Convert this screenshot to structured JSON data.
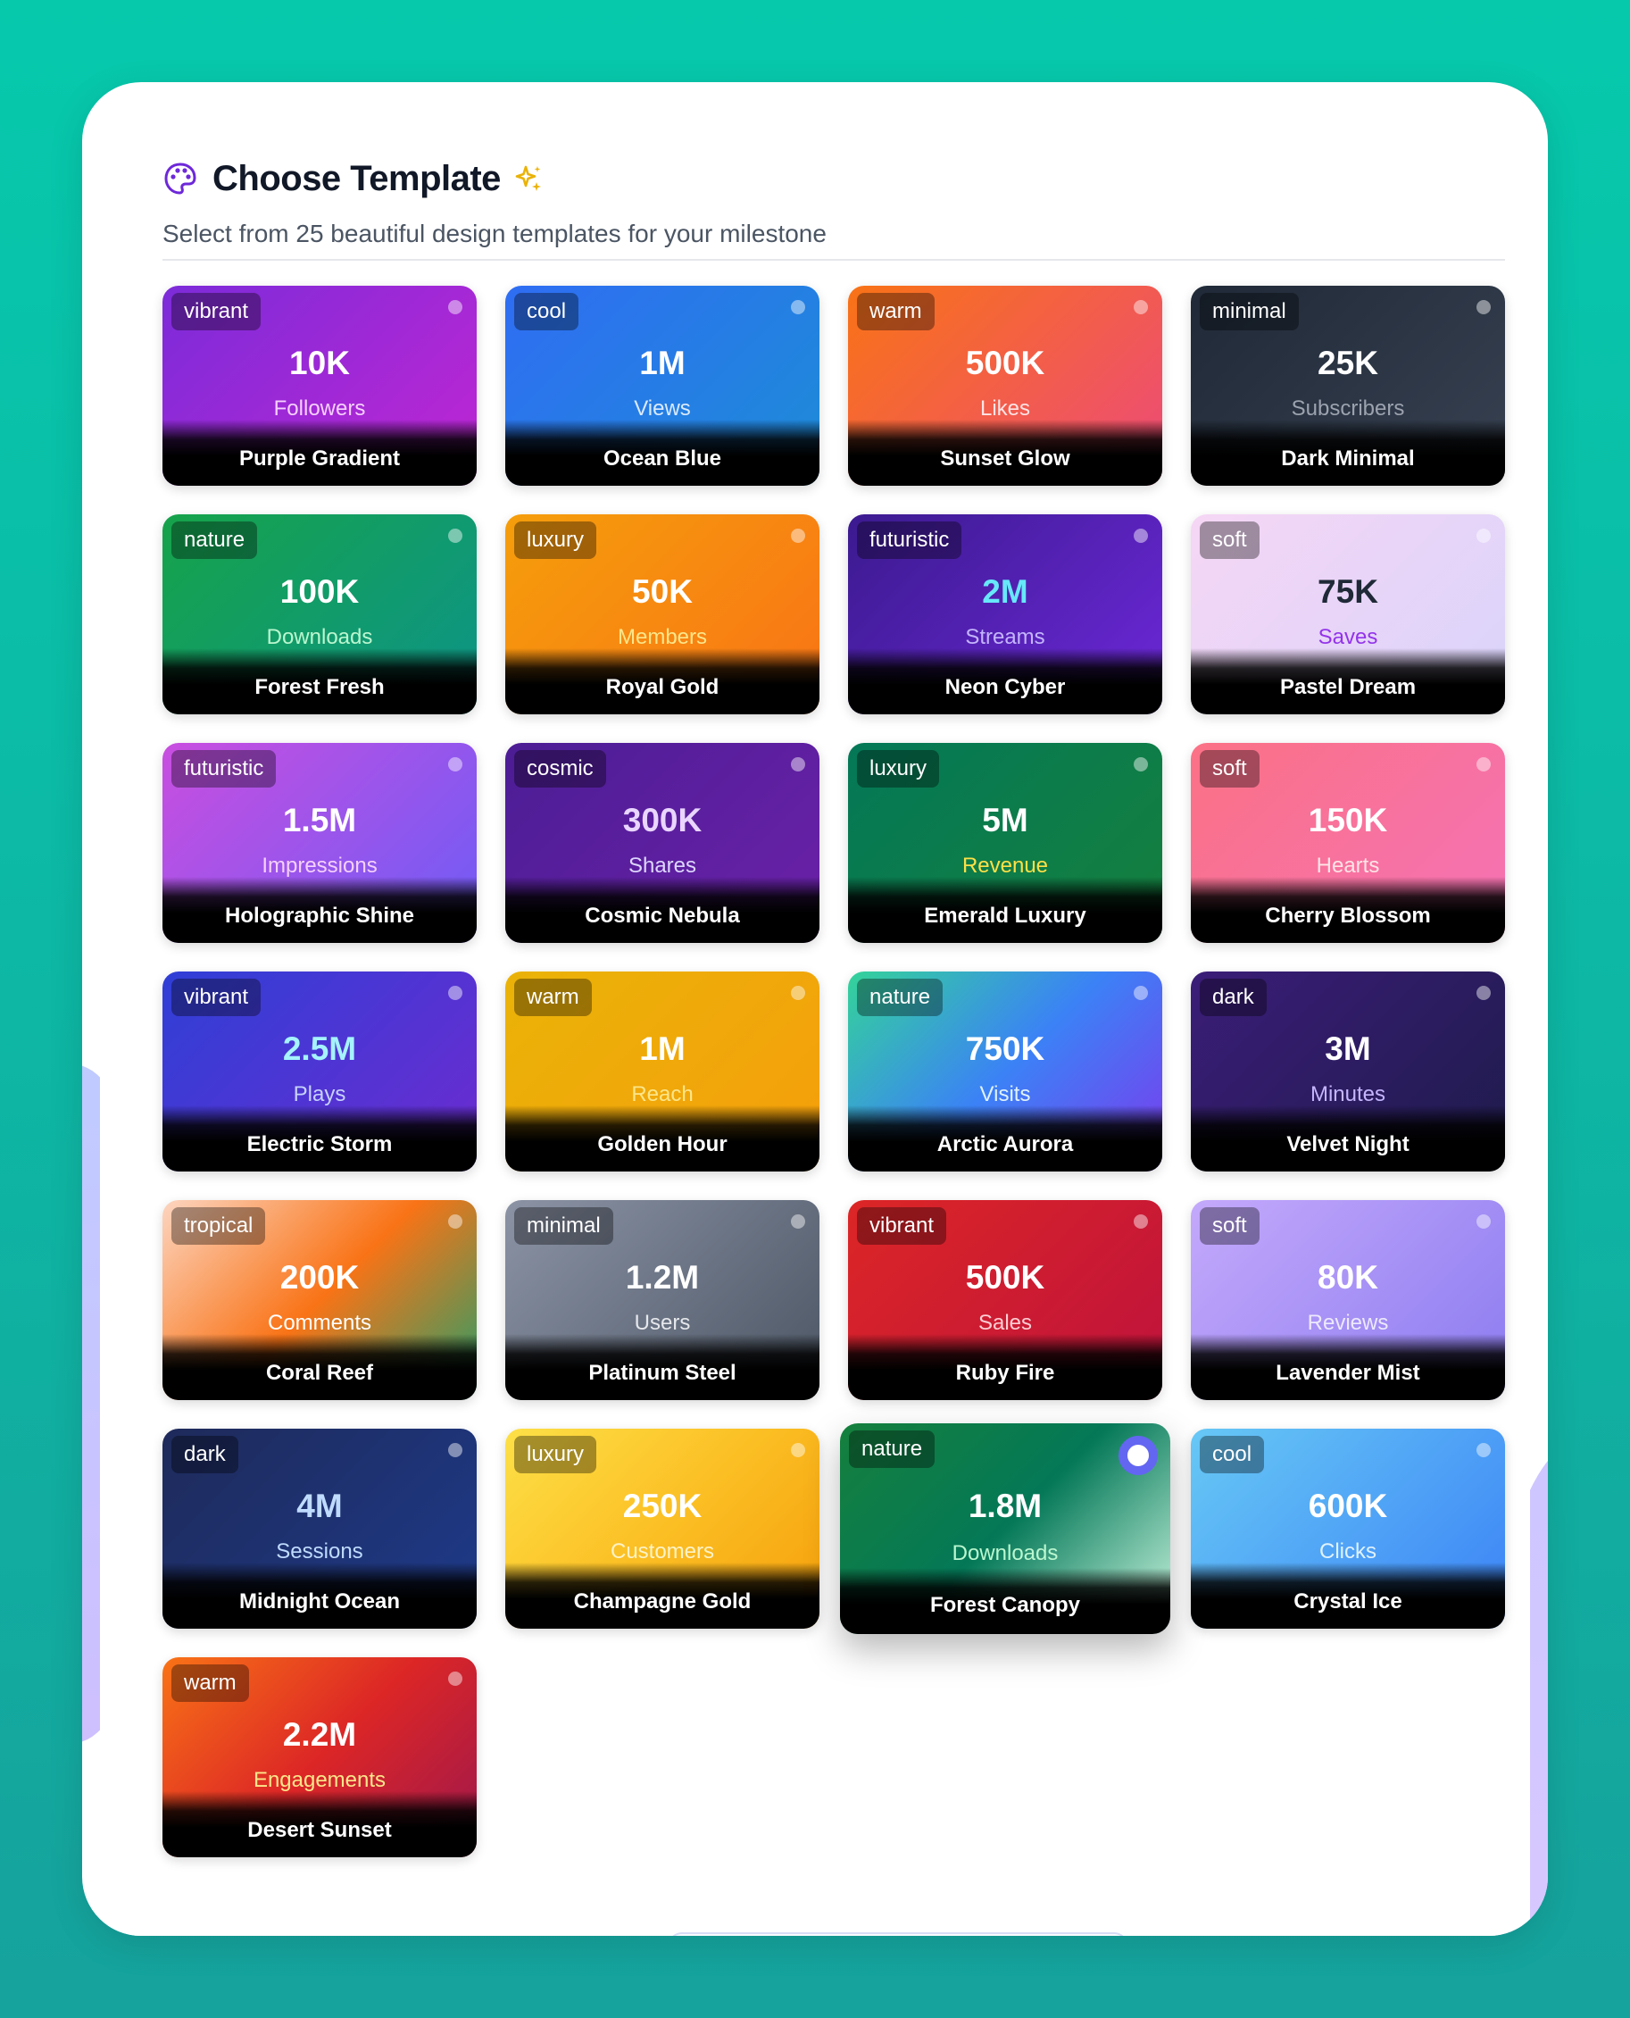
{
  "header": {
    "title": "Choose Template",
    "subtitle": "Select from 25 beautiful design templates for your milestone",
    "title_icon": "palette-icon",
    "title_accent_icon": "sparkle-icon"
  },
  "selected_template": "Forest Canopy",
  "templates": [
    {
      "category": "vibrant",
      "value": "10K",
      "metric": "Followers",
      "name": "Purple Gradient",
      "gradient": [
        "#7c2bd9",
        "#c026d3"
      ],
      "metric_color": "#f5d0fe"
    },
    {
      "category": "cool",
      "value": "1M",
      "metric": "Views",
      "name": "Ocean Blue",
      "gradient": [
        "#2f6df3",
        "#1d8cd7"
      ],
      "metric_color": "#dbeafe"
    },
    {
      "category": "warm",
      "value": "500K",
      "metric": "Likes",
      "name": "Sunset Glow",
      "gradient": [
        "#f97316",
        "#ec4a7a"
      ],
      "metric_color": "#ffe4e6"
    },
    {
      "category": "minimal",
      "value": "25K",
      "metric": "Subscribers",
      "name": "Dark Minimal",
      "gradient": [
        "#1f2937",
        "#374151"
      ],
      "metric_color": "#9ca3af"
    },
    {
      "category": "nature",
      "value": "100K",
      "metric": "Downloads",
      "name": "Forest Fresh",
      "gradient": [
        "#16a34a",
        "#0d9488"
      ],
      "metric_color": "#bbf7d0"
    },
    {
      "category": "luxury",
      "value": "50K",
      "metric": "Members",
      "name": "Royal Gold",
      "gradient": [
        "#f59e0b",
        "#f97316"
      ],
      "metric_color": "#fde68a"
    },
    {
      "category": "futuristic",
      "value": "2M",
      "metric": "Streams",
      "name": "Neon Cyber",
      "gradient": [
        "#3b1a8f",
        "#6d28d9"
      ],
      "metric_color": "#c4b5fd",
      "value_color": "#67e8f9"
    },
    {
      "category": "soft",
      "value": "75K",
      "metric": "Saves",
      "name": "Pastel Dream",
      "gradient": [
        "#f6d6f5",
        "#d9d4fb"
      ],
      "metric_color": "#9333ea",
      "value_color": "#1f2937"
    },
    {
      "category": "futuristic",
      "value": "1.5M",
      "metric": "Impressions",
      "name": "Holographic Shine",
      "gradient": [
        "#c94ee0",
        "#6d5cf6"
      ],
      "metric_color": "#f5d0fe"
    },
    {
      "category": "cosmic",
      "value": "300K",
      "metric": "Shares",
      "name": "Cosmic Nebula",
      "gradient": [
        "#4c1d95",
        "#6b21a8"
      ],
      "metric_color": "#ddd6fe",
      "value_color": "#e9d5ff"
    },
    {
      "category": "luxury",
      "value": "5M",
      "metric": "Revenue",
      "name": "Emerald Luxury",
      "gradient": [
        "#047857",
        "#15803d"
      ],
      "metric_color": "#fde047"
    },
    {
      "category": "soft",
      "value": "150K",
      "metric": "Hearts",
      "name": "Cherry Blossom",
      "gradient": [
        "#fb7185",
        "#f472b6"
      ],
      "metric_color": "#ffe4e6"
    },
    {
      "category": "vibrant",
      "value": "2.5M",
      "metric": "Plays",
      "name": "Electric Storm",
      "gradient": [
        "#2f3fd6",
        "#6d2bd0"
      ],
      "metric_color": "#c7d2fe",
      "value_color": "#a5f3fc"
    },
    {
      "category": "warm",
      "value": "1M",
      "metric": "Reach",
      "name": "Golden Hour",
      "gradient": [
        "#eab308",
        "#f59e0b"
      ],
      "metric_color": "#fde68a"
    },
    {
      "category": "nature",
      "value": "750K",
      "metric": "Visits",
      "name": "Arctic Aurora",
      "gradient": [
        "#34d399",
        "#3b82f6",
        "#7c3aed"
      ],
      "metric_color": "#e0f2fe"
    },
    {
      "category": "dark",
      "value": "3M",
      "metric": "Minutes",
      "name": "Velvet Night",
      "gradient": [
        "#3b1d78",
        "#1e1b4b"
      ],
      "metric_color": "#c4b5fd"
    },
    {
      "category": "tropical",
      "value": "200K",
      "metric": "Comments",
      "name": "Coral Reef",
      "gradient": [
        "#fcd5c0",
        "#f97316",
        "#22a06b"
      ],
      "metric_color": "#ffffff"
    },
    {
      "category": "minimal",
      "value": "1.2M",
      "metric": "Users",
      "name": "Platinum Steel",
      "gradient": [
        "#8b93a5",
        "#4b5563"
      ],
      "metric_color": "#e5e7eb"
    },
    {
      "category": "vibrant",
      "value": "500K",
      "metric": "Sales",
      "name": "Ruby Fire",
      "gradient": [
        "#dc2626",
        "#be123c"
      ],
      "metric_color": "#fecdd3"
    },
    {
      "category": "soft",
      "value": "80K",
      "metric": "Reviews",
      "name": "Lavender Mist",
      "gradient": [
        "#c4a9fb",
        "#8b7bf0"
      ],
      "metric_color": "#ede9fe"
    },
    {
      "category": "dark",
      "value": "4M",
      "metric": "Sessions",
      "name": "Midnight Ocean",
      "gradient": [
        "#1e2a5a",
        "#1e3a8a"
      ],
      "metric_color": "#bfdbfe",
      "value_color": "#bfdbfe"
    },
    {
      "category": "luxury",
      "value": "250K",
      "metric": "Customers",
      "name": "Champagne Gold",
      "gradient": [
        "#fde047",
        "#fbbf24",
        "#f59e0b"
      ],
      "metric_color": "#fef3c7"
    },
    {
      "category": "nature",
      "value": "1.8M",
      "metric": "Downloads",
      "name": "Forest Canopy",
      "gradient": [
        "#15803d",
        "#047857",
        "#d1fae5"
      ],
      "metric_color": "#bbf7d0"
    },
    {
      "category": "cool",
      "value": "600K",
      "metric": "Clicks",
      "name": "Crystal Ice",
      "gradient": [
        "#67c8f5",
        "#3b82f6"
      ],
      "metric_color": "#e0f2fe"
    },
    {
      "category": "warm",
      "value": "2.2M",
      "metric": "Engagements",
      "name": "Desert Sunset",
      "gradient": [
        "#f97316",
        "#dc2626",
        "#9d174d"
      ],
      "metric_color": "#fde68a"
    }
  ]
}
